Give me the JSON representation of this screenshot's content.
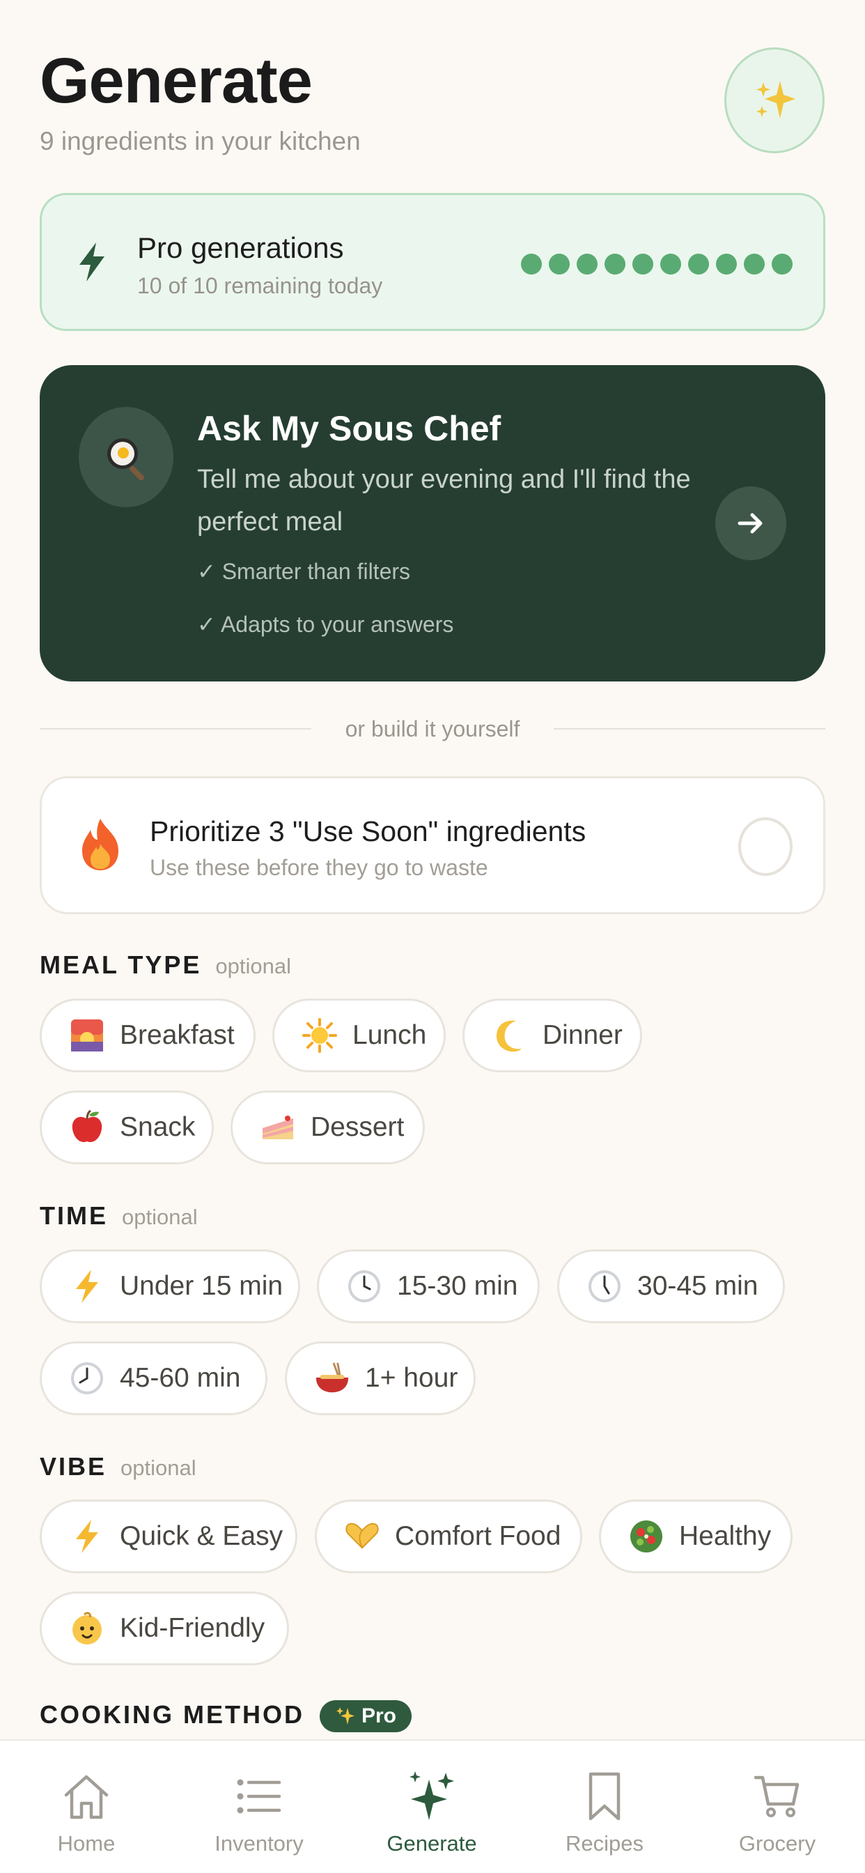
{
  "header": {
    "title": "Generate",
    "subtitle": "9 ingredients in your kitchen"
  },
  "pro_generations": {
    "title": "Pro generations",
    "subtitle": "10 of 10 remaining today",
    "remaining": 10,
    "total": 10,
    "dot_color": "#5aab73"
  },
  "sous_chef": {
    "title": "Ask My Sous Chef",
    "description": "Tell me about your evening and I'll find the perfect meal",
    "bullet1": "✓ Smarter than filters",
    "bullet2": "✓ Adapts to your answers",
    "icon": "frying-pan-icon"
  },
  "divider_text": "or build it yourself",
  "use_soon": {
    "title": "Prioritize 3 \"Use Soon\" ingredients",
    "subtitle": "Use these before they go to waste",
    "checked": false,
    "icon": "fire-icon"
  },
  "sections": {
    "meal_type": {
      "label": "MEAL TYPE",
      "optional": "optional"
    },
    "time": {
      "label": "TIME",
      "optional": "optional"
    },
    "vibe": {
      "label": "VIBE",
      "optional": "optional"
    },
    "cooking_method": {
      "label": "COOKING METHOD",
      "badge": "Pro"
    }
  },
  "meal_type_chips": [
    {
      "label": "Breakfast",
      "icon": "sunrise-icon"
    },
    {
      "label": "Lunch",
      "icon": "sun-icon"
    },
    {
      "label": "Dinner",
      "icon": "moon-icon"
    },
    {
      "label": "Snack",
      "icon": "apple-icon"
    },
    {
      "label": "Dessert",
      "icon": "cake-icon"
    }
  ],
  "time_chips": [
    {
      "label": "Under 15 min",
      "icon": "lightning-icon"
    },
    {
      "label": "15-30 min",
      "icon": "clock-icon"
    },
    {
      "label": "30-45 min",
      "icon": "clock-icon"
    },
    {
      "label": "45-60 min",
      "icon": "clock-icon"
    },
    {
      "label": "1+ hour",
      "icon": "pot-icon"
    }
  ],
  "vibe_chips": [
    {
      "label": "Quick & Easy",
      "icon": "lightning-icon"
    },
    {
      "label": "Comfort Food",
      "icon": "heart-hands-icon"
    },
    {
      "label": "Healthy",
      "icon": "salad-icon"
    },
    {
      "label": "Kid-Friendly",
      "icon": "baby-icon"
    }
  ],
  "nav": [
    {
      "label": "Home",
      "icon": "home-icon",
      "active": false
    },
    {
      "label": "Inventory",
      "icon": "list-icon",
      "active": false
    },
    {
      "label": "Generate",
      "icon": "sparkles-icon",
      "active": true
    },
    {
      "label": "Recipes",
      "icon": "bookmark-icon",
      "active": false
    },
    {
      "label": "Grocery",
      "icon": "cart-icon",
      "active": false
    }
  ],
  "colors": {
    "background": "#fcf9f4",
    "brand_dark_green": "#263e32",
    "accent_green": "#2d5b3d",
    "mint": "#ebf7ee"
  }
}
